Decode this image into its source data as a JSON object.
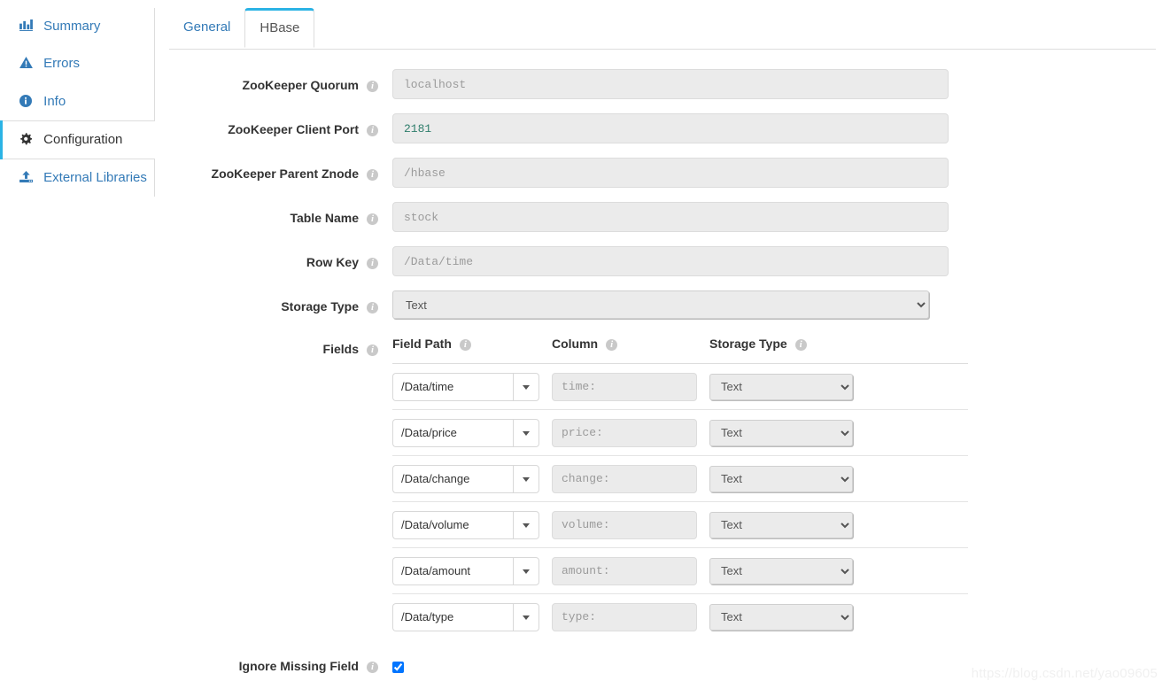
{
  "sidebar": {
    "items": [
      {
        "label": "Summary",
        "icon": "bar-chart-icon",
        "active": false
      },
      {
        "label": "Errors",
        "icon": "warning-icon",
        "active": false
      },
      {
        "label": "Info",
        "icon": "info-circle-icon",
        "active": false
      },
      {
        "label": "Configuration",
        "icon": "gear-icon",
        "active": true
      },
      {
        "label": "External Libraries",
        "icon": "upload-icon",
        "active": false
      }
    ]
  },
  "tabs": [
    {
      "label": "General",
      "active": false
    },
    {
      "label": "HBase",
      "active": true
    }
  ],
  "form": {
    "rows": [
      {
        "label": "ZooKeeper Quorum",
        "type": "text",
        "value": "",
        "placeholder": "localhost"
      },
      {
        "label": "ZooKeeper Client Port",
        "type": "text",
        "value": "2181",
        "placeholder": ""
      },
      {
        "label": "ZooKeeper Parent Znode",
        "type": "text",
        "value": "",
        "placeholder": "/hbase"
      },
      {
        "label": "Table Name",
        "type": "text",
        "value": "",
        "placeholder": "stock"
      },
      {
        "label": "Row Key",
        "type": "text",
        "value": "",
        "placeholder": "/Data/time"
      },
      {
        "label": "Storage Type",
        "type": "select",
        "value": "Text",
        "placeholder": ""
      }
    ],
    "fields_label": "Fields",
    "ignore_missing_label": "Ignore Missing Field",
    "ignore_missing_checked": true
  },
  "fields_table": {
    "headers": [
      {
        "label": "Field Path"
      },
      {
        "label": "Column"
      },
      {
        "label": "Storage Type"
      }
    ],
    "rows": [
      {
        "path": "/Data/time",
        "column_placeholder": "time:",
        "storage": "Text"
      },
      {
        "path": "/Data/price",
        "column_placeholder": "price:",
        "storage": "Text"
      },
      {
        "path": "/Data/change",
        "column_placeholder": "change:",
        "storage": "Text"
      },
      {
        "path": "/Data/volume",
        "column_placeholder": "volume:",
        "storage": "Text"
      },
      {
        "path": "/Data/amount",
        "column_placeholder": "amount:",
        "storage": "Text"
      },
      {
        "path": "/Data/type",
        "column_placeholder": "type:",
        "storage": "Text"
      }
    ],
    "storage_options": [
      "Text"
    ]
  },
  "watermark": "https://blog.csdn.net/yao09605",
  "colors": {
    "accent": "#2bb3e5",
    "link": "#337ab7",
    "value_text": "#2e7d6b",
    "placeholder": "#9b9b9b",
    "border": "#dddddd"
  }
}
